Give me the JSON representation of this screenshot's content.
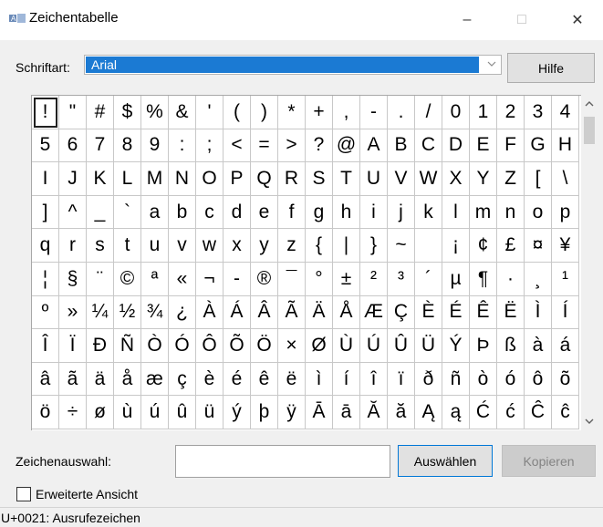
{
  "window": {
    "title": "Zeichentabelle",
    "min_glyph": "–",
    "max_glyph": "□",
    "close_glyph": "✕"
  },
  "font_row": {
    "label": "Schriftart:",
    "selected_font": "Arial",
    "help_label": "Hilfe"
  },
  "grid": {
    "selected_index": 0,
    "chars": [
      "!",
      "\"",
      "#",
      "$",
      "%",
      "&",
      "'",
      "(",
      ")",
      "*",
      "+",
      ",",
      "-",
      ".",
      "/",
      "0",
      "1",
      "2",
      "3",
      "4",
      "5",
      "6",
      "7",
      "8",
      "9",
      ":",
      ";",
      "<",
      "=",
      ">",
      "?",
      "@",
      "A",
      "B",
      "C",
      "D",
      "E",
      "F",
      "G",
      "H",
      "I",
      "J",
      "K",
      "L",
      "M",
      "N",
      "O",
      "P",
      "Q",
      "R",
      "S",
      "T",
      "U",
      "V",
      "W",
      "X",
      "Y",
      "Z",
      "[",
      "\\",
      "]",
      "^",
      "_",
      "`",
      "a",
      "b",
      "c",
      "d",
      "e",
      "f",
      "g",
      "h",
      "i",
      "j",
      "k",
      "l",
      "m",
      "n",
      "o",
      "p",
      "q",
      "r",
      "s",
      "t",
      "u",
      "v",
      "w",
      "x",
      "y",
      "z",
      "{",
      "|",
      "}",
      "~",
      "",
      "¡",
      "¢",
      "£",
      "¤",
      "¥",
      "¦",
      "§",
      "¨",
      "©",
      "ª",
      "«",
      "¬",
      "-",
      "®",
      "¯",
      "°",
      "±",
      "²",
      "³",
      "´",
      "µ",
      "¶",
      "·",
      "¸",
      "¹",
      "º",
      "»",
      "¼",
      "½",
      "¾",
      "¿",
      "À",
      "Á",
      "Â",
      "Ã",
      "Ä",
      "Å",
      "Æ",
      "Ç",
      "È",
      "É",
      "Ê",
      "Ë",
      "Ì",
      "Í",
      "Î",
      "Ï",
      "Ð",
      "Ñ",
      "Ò",
      "Ó",
      "Ô",
      "Õ",
      "Ö",
      "×",
      "Ø",
      "Ù",
      "Ú",
      "Û",
      "Ü",
      "Ý",
      "Þ",
      "ß",
      "à",
      "á",
      "â",
      "ã",
      "ä",
      "å",
      "æ",
      "ç",
      "è",
      "é",
      "ê",
      "ë",
      "ì",
      "í",
      "î",
      "ï",
      "ð",
      "ñ",
      "ò",
      "ó",
      "ô",
      "õ",
      "ö",
      "÷",
      "ø",
      "ù",
      "ú",
      "û",
      "ü",
      "ý",
      "þ",
      "ÿ",
      "Ā",
      "ā",
      "Ă",
      "ă",
      "Ą",
      "ą",
      "Ć",
      "ć",
      "Ĉ",
      "ĉ"
    ]
  },
  "selection": {
    "label": "Zeichenauswahl:",
    "input_value": "",
    "select_button": "Auswählen",
    "copy_button": "Kopieren"
  },
  "advanced": {
    "label": "Erweiterte Ansicht",
    "checked": false
  },
  "status": {
    "text": "U+0021: Ausrufezeichen"
  }
}
